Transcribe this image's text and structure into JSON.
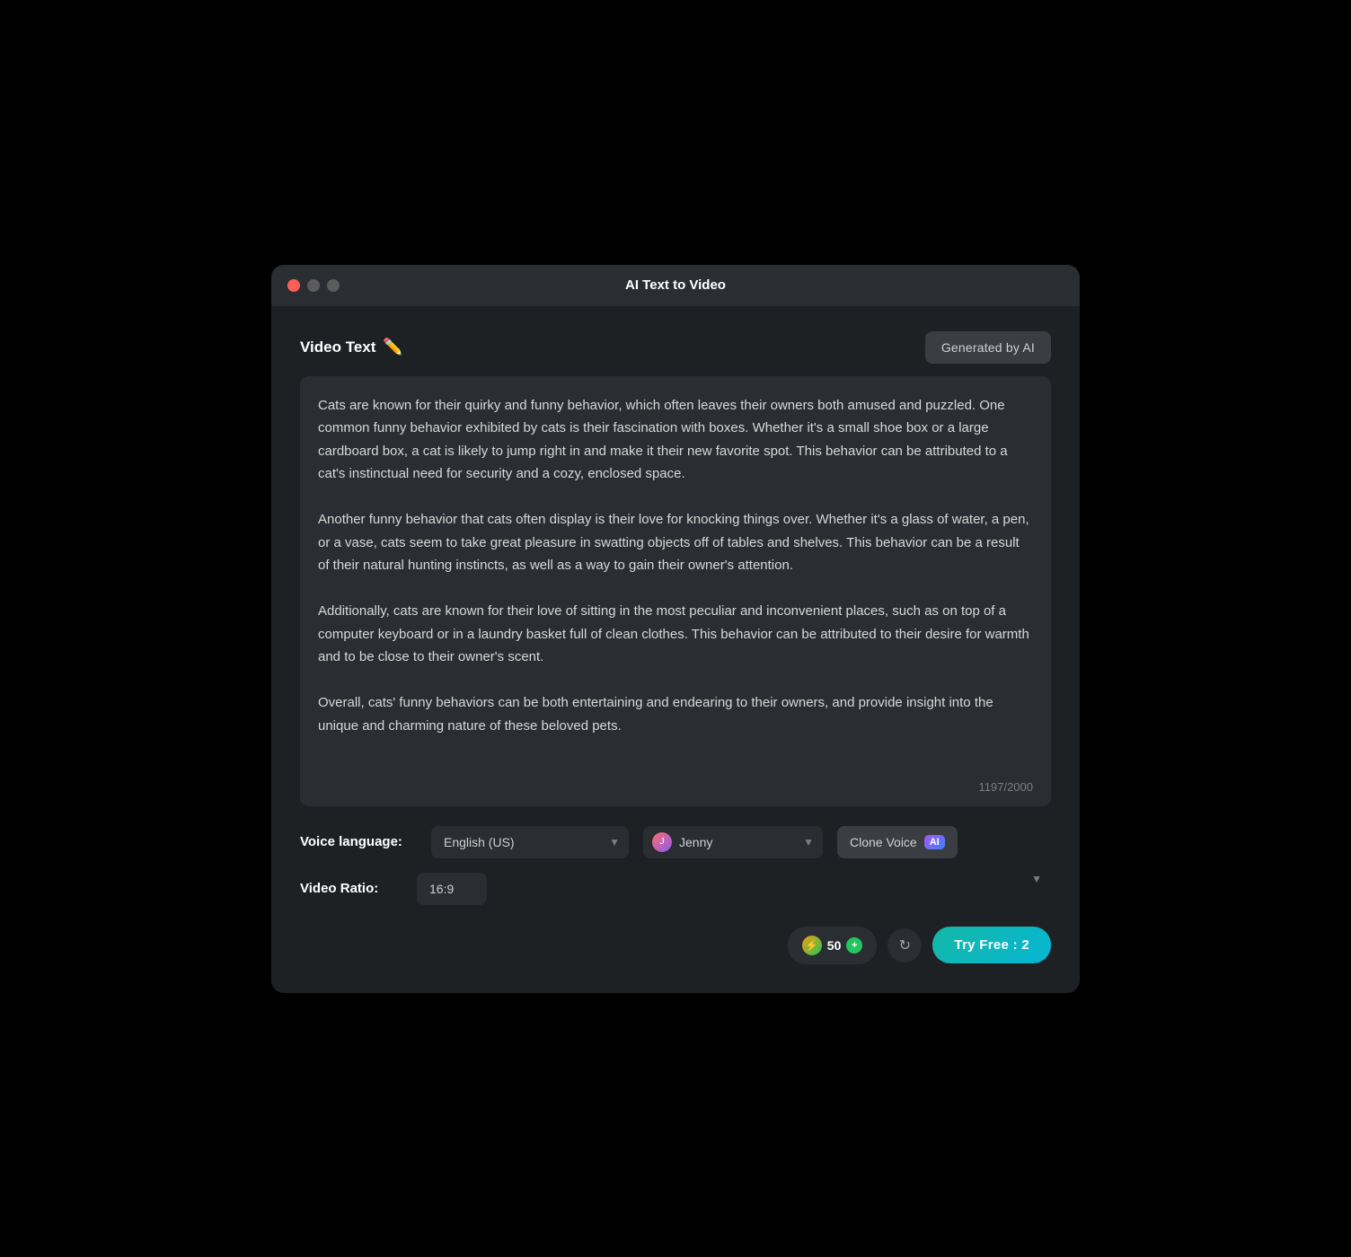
{
  "window": {
    "title": "AI Text to Video",
    "traffic_lights": {
      "close_label": "close",
      "minimize_label": "minimize",
      "maximize_label": "maximize"
    }
  },
  "section": {
    "title": "Video Text",
    "generated_btn_label": "Generated by AI",
    "textarea_content": "Cats are known for their quirky and funny behavior, which often leaves their owners both amused and puzzled. One common funny behavior exhibited by cats is their fascination with boxes. Whether it's a small shoe box or a large cardboard box, a cat is likely to jump right in and make it their new favorite spot. This behavior can be attributed to a cat's instinctual need for security and a cozy, enclosed space.\n\nAnother funny behavior that cats often display is their love for knocking things over. Whether it's a glass of water, a pen, or a vase, cats seem to take great pleasure in swatting objects off of tables and shelves. This behavior can be a result of their natural hunting instincts, as well as a way to gain their owner's attention.\n\nAdditionally, cats are known for their love of sitting in the most peculiar and inconvenient places, such as on top of a computer keyboard or in a laundry basket full of clean clothes. This behavior can be attributed to their desire for warmth and to be close to their owner's scent.\n\nOverall, cats' funny behaviors can be both entertaining and endearing to their owners, and provide insight into the unique and charming nature of these beloved pets.",
    "char_count": "1197/2000"
  },
  "voice": {
    "language_label": "Voice language:",
    "language_value": "English (US)",
    "name_value": "Jenny",
    "clone_voice_label": "Clone Voice",
    "ai_badge": "AI"
  },
  "video": {
    "ratio_label": "Video Ratio:",
    "ratio_value": "16:9"
  },
  "footer": {
    "credits_count": "50",
    "plus_label": "+",
    "refresh_label": "↻",
    "try_free_label": "Try Free : 2"
  }
}
